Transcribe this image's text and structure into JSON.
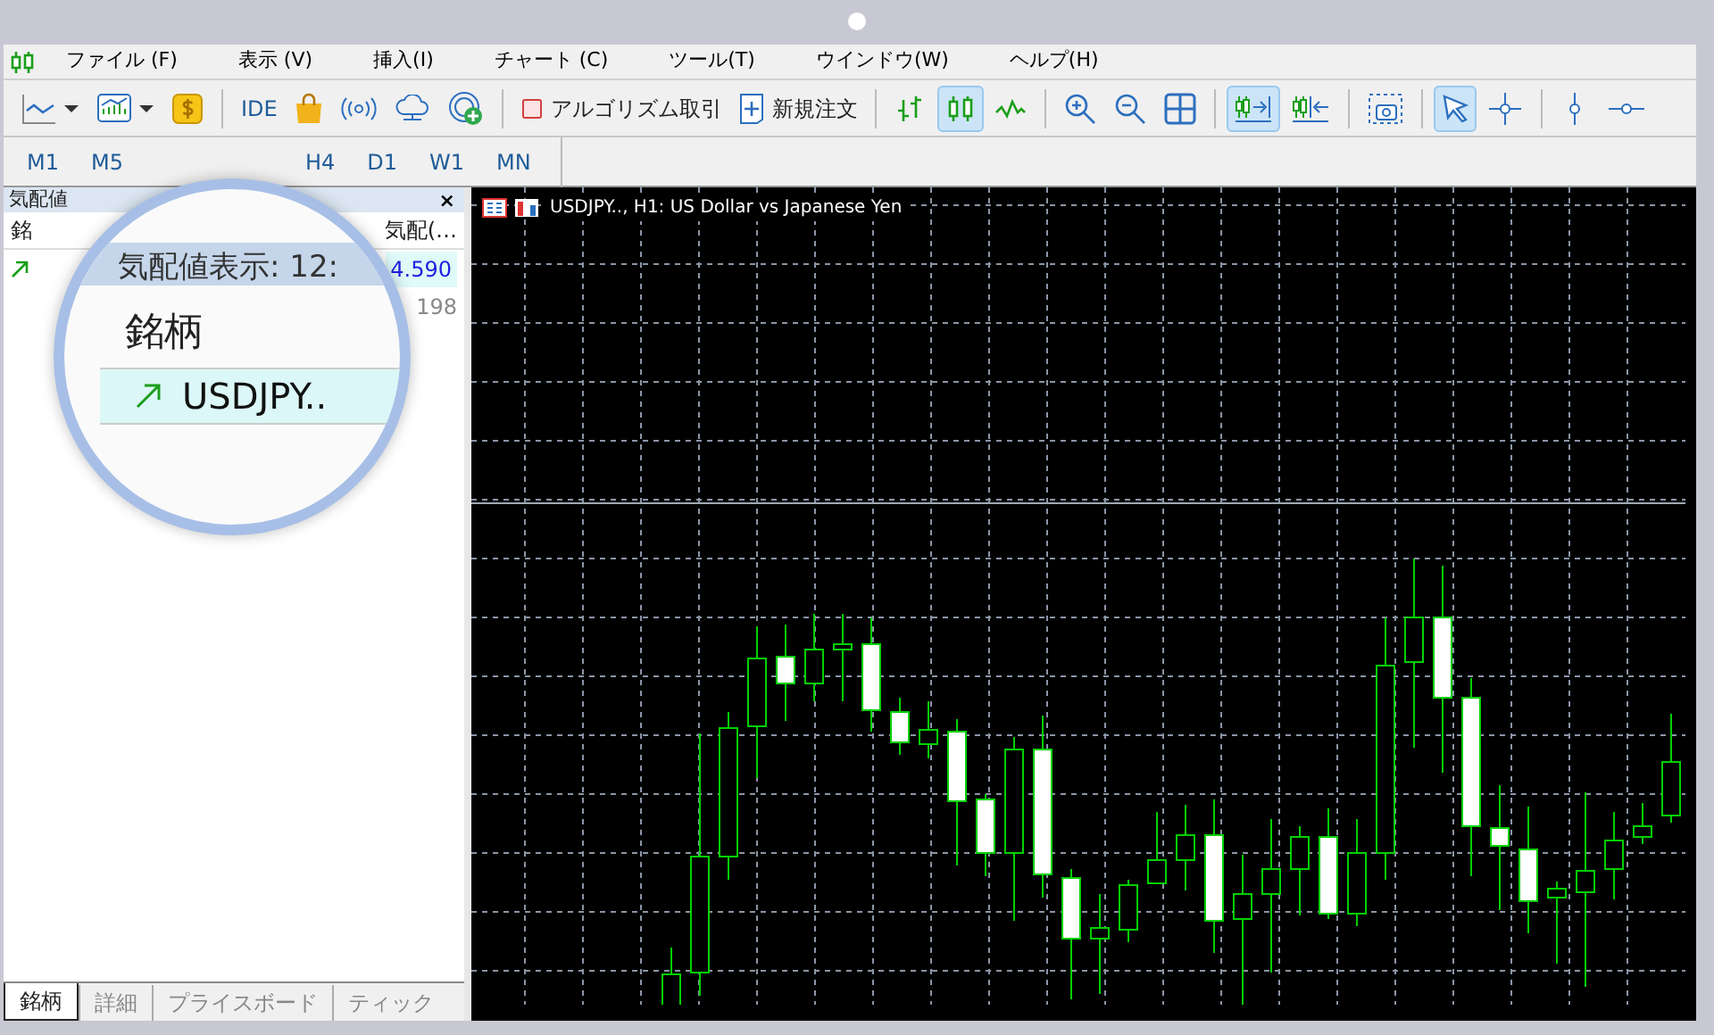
{
  "menu": [
    "ファイル (F)",
    "表示 (V)",
    "挿入(I)",
    "チャート (C)",
    "ツール(T)",
    "ウインドウ(W)",
    "ヘルプ(H)"
  ],
  "toolbar": {
    "ide_label": "IDE",
    "algo_trading_label": "アルゴリズム取引",
    "new_order_label": "新規注文",
    "bar_view_selected": false,
    "candle_view_selected": true,
    "line_view_selected": false,
    "autoscroll_selected": true,
    "chart_shift_selected": false,
    "cursor_selected": true,
    "crosshair_selected": false
  },
  "timeframes": [
    {
      "label": "M1",
      "selected": false
    },
    {
      "label": "M5",
      "selected": false
    },
    {
      "label": "H4",
      "selected": false
    },
    {
      "label": "D1",
      "selected": false
    },
    {
      "label": "W1",
      "selected": false
    },
    {
      "label": "MN",
      "selected": false
    }
  ],
  "market_watch": {
    "title": "気配値",
    "close_label": "×",
    "column_header": "銘",
    "column_header_2": "気配(…",
    "rows": [
      {
        "trend_up": true,
        "price": "4.590",
        "selected": true
      },
      {
        "trend_up": false,
        "price": "198",
        "selected": false
      }
    ],
    "tabs": [
      {
        "label": "銘柄",
        "selected": true
      },
      {
        "label": "詳細",
        "selected": false
      },
      {
        "label": "プライスボード",
        "selected": false
      },
      {
        "label": "ティック",
        "selected": false
      }
    ]
  },
  "magnifier": {
    "title": "気配値表示: 12:",
    "column_header": "銘柄",
    "rows": [
      {
        "trend_up": true,
        "symbol": "USDJPY..",
        "selected": true
      }
    ]
  },
  "chart": {
    "title": "USDJPY.., H1:  US Dollar vs Japanese Yen"
  }
}
